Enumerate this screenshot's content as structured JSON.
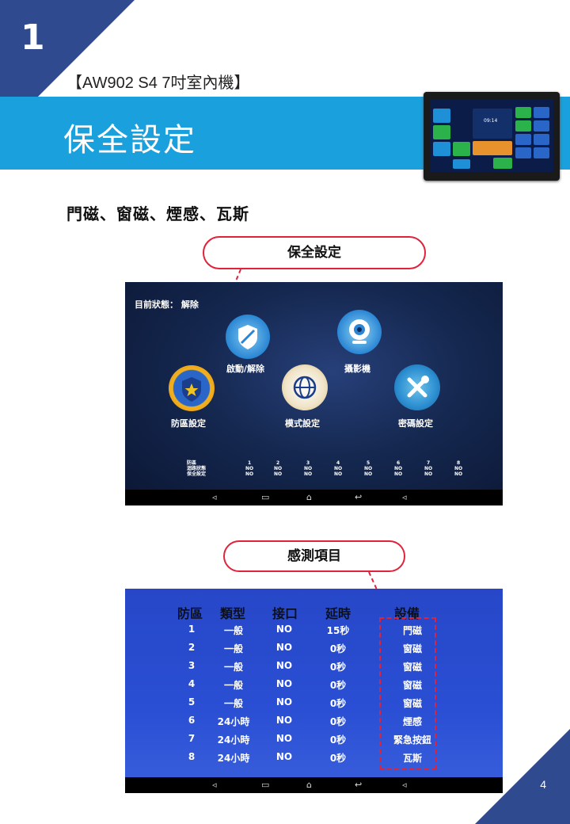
{
  "section_number": "1",
  "page_number": "4",
  "product_title": "【AW902 S4 7吋室內機】",
  "banner_title": "保全設定",
  "subheading": "門磁、窗磁、煙感、瓦斯",
  "callouts": [
    "保全設定",
    "感測項目"
  ],
  "screen1": {
    "status_label": "目前狀態：",
    "status_value": "解除",
    "buttons": [
      {
        "label": "啟動/解除",
        "icon": "shield-icon"
      },
      {
        "label": "攝影機",
        "icon": "camera-icon"
      },
      {
        "label": "防區設定",
        "icon": "star-badge-icon"
      },
      {
        "label": "模式設定",
        "icon": "globe-icon"
      },
      {
        "label": "密碼設定",
        "icon": "tools-icon"
      }
    ],
    "zone_row_labels": [
      "防區",
      "迴路狀態",
      "保全設定"
    ],
    "zones": [
      {
        "num": "1",
        "loop": "NO",
        "guard": "NO"
      },
      {
        "num": "2",
        "loop": "NO",
        "guard": "NO"
      },
      {
        "num": "3",
        "loop": "NO",
        "guard": "NO"
      },
      {
        "num": "4",
        "loop": "NO",
        "guard": "NO"
      },
      {
        "num": "5",
        "loop": "NO",
        "guard": "NO"
      },
      {
        "num": "6",
        "loop": "NO",
        "guard": "NO"
      },
      {
        "num": "7",
        "loop": "NO",
        "guard": "NO"
      },
      {
        "num": "8",
        "loop": "NO",
        "guard": "NO"
      }
    ]
  },
  "screen2": {
    "headers": [
      "防區",
      "類型",
      "接口",
      "延時",
      "設備"
    ],
    "rows": [
      [
        "1",
        "一般",
        "NO",
        "15秒",
        "門磁"
      ],
      [
        "2",
        "一般",
        "NO",
        "0秒",
        "窗磁"
      ],
      [
        "3",
        "一般",
        "NO",
        "0秒",
        "窗磁"
      ],
      [
        "4",
        "一般",
        "NO",
        "0秒",
        "窗磁"
      ],
      [
        "5",
        "一般",
        "NO",
        "0秒",
        "窗磁"
      ],
      [
        "6",
        "24小時",
        "NO",
        "0秒",
        "煙感"
      ],
      [
        "7",
        "24小時",
        "NO",
        "0秒",
        "緊急按鈕"
      ],
      [
        "8",
        "24小時",
        "NO",
        "0秒",
        "瓦斯"
      ]
    ]
  },
  "navbar_icons": [
    "volume-down-icon",
    "recent-apps-icon",
    "home-icon",
    "back-icon",
    "volume-up-icon"
  ],
  "device_screen": {
    "time": "09:14"
  },
  "colors": {
    "banner": "#1aa0dc",
    "corner": "#2f4a8f",
    "callout_border": "#e0233a"
  }
}
